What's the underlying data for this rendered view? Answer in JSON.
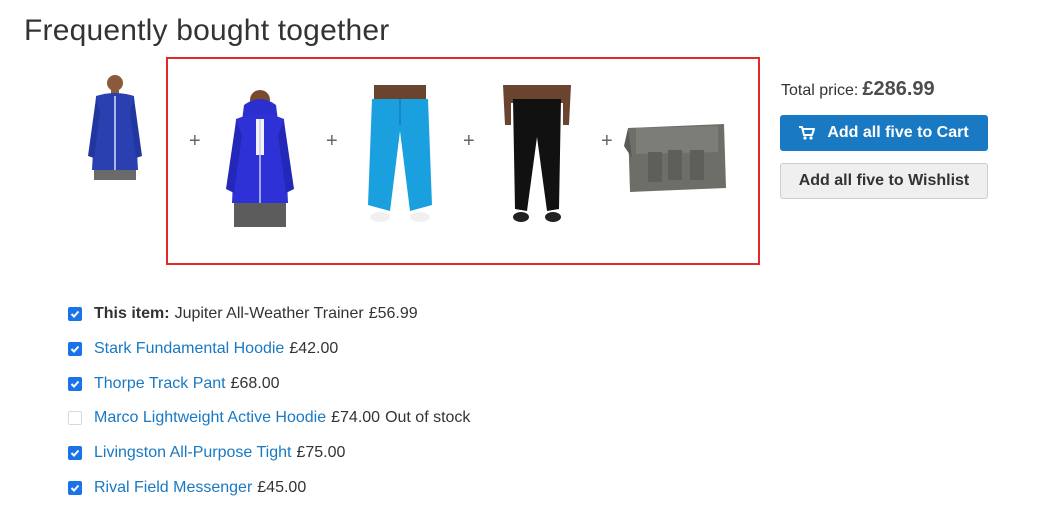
{
  "title": "Frequently bought together",
  "total": {
    "label": "Total price:",
    "value": "£286.99"
  },
  "buttons": {
    "cart": "Add all five to Cart",
    "wishlist": "Add all five to Wishlist"
  },
  "plus": "+",
  "items": [
    {
      "prefix": "This item:",
      "name": "Jupiter All-Weather Trainer",
      "price": "£56.99",
      "checked": true,
      "status": ""
    },
    {
      "prefix": "",
      "name": "Stark Fundamental Hoodie",
      "price": "£42.00",
      "checked": true,
      "status": ""
    },
    {
      "prefix": "",
      "name": "Thorpe Track Pant",
      "price": "£68.00",
      "checked": true,
      "status": ""
    },
    {
      "prefix": "",
      "name": "Marco Lightweight Active Hoodie",
      "price": "£74.00",
      "checked": false,
      "status": "Out of stock"
    },
    {
      "prefix": "",
      "name": "Livingston All-Purpose Tight",
      "price": "£75.00",
      "checked": true,
      "status": ""
    },
    {
      "prefix": "",
      "name": "Rival Field Messenger",
      "price": "£45.00",
      "checked": true,
      "status": ""
    }
  ],
  "colors": {
    "accent": "#1979c3",
    "highlight_border": "#e02b27",
    "checkbox": "#1a73e8"
  }
}
